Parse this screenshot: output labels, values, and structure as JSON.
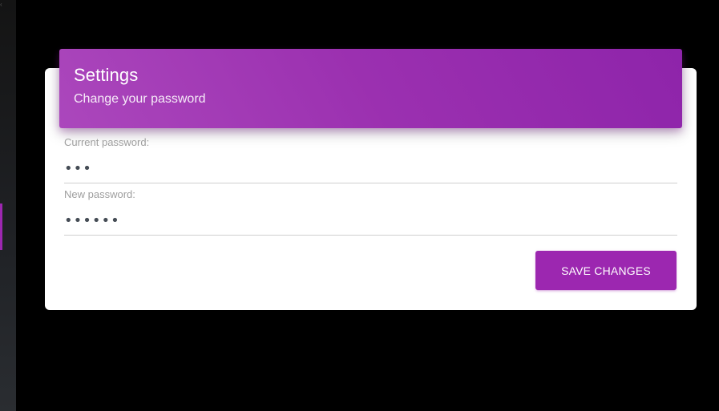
{
  "settings": {
    "title": "Settings",
    "subtitle": "Change your password"
  },
  "form": {
    "current_password": {
      "label": "Current password:",
      "value": "•••"
    },
    "new_password": {
      "label": "New password:",
      "value": "••••••"
    },
    "save_label": "SAVE CHANGES"
  },
  "colors": {
    "accent": "#9c27b0",
    "background": "#000000",
    "card": "#ffffff"
  }
}
